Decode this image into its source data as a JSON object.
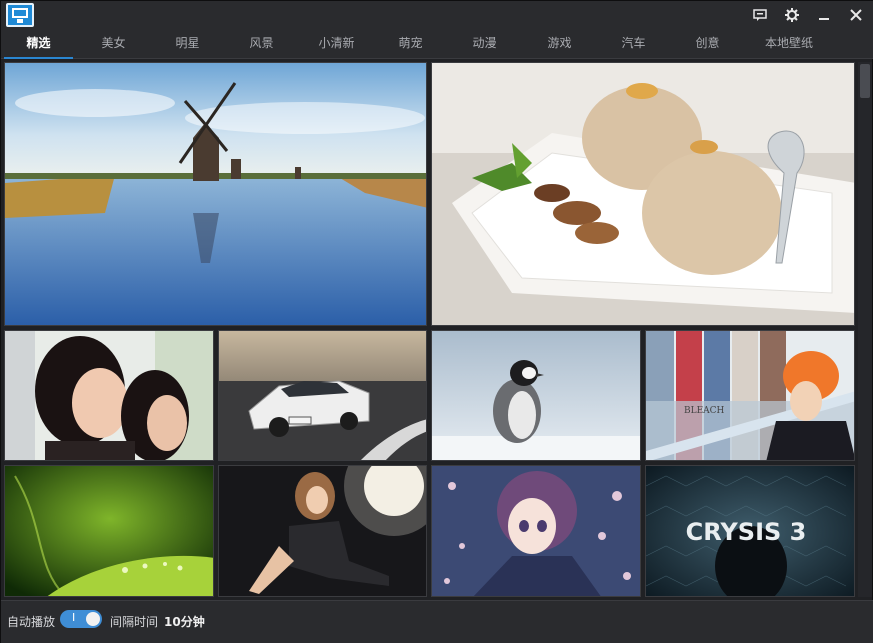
{
  "titlebar": {
    "icons": [
      "app-logo-icon",
      "feedback-icon",
      "settings-gear-icon",
      "minimize-icon",
      "close-icon"
    ]
  },
  "tabs": [
    {
      "label": "精选",
      "active": true
    },
    {
      "label": "美女",
      "active": false
    },
    {
      "label": "明星",
      "active": false
    },
    {
      "label": "风景",
      "active": false
    },
    {
      "label": "小清新",
      "active": false
    },
    {
      "label": "萌宠",
      "active": false
    },
    {
      "label": "动漫",
      "active": false
    },
    {
      "label": "游戏",
      "active": false
    },
    {
      "label": "汽车",
      "active": false
    },
    {
      "label": "创意",
      "active": false
    },
    {
      "label": "本地壁纸",
      "active": false
    }
  ],
  "gallery": {
    "tiles": [
      {
        "name": "windmill-landscape-image"
      },
      {
        "name": "ice-cream-dessert-image"
      },
      {
        "name": "two-women-portrait-image"
      },
      {
        "name": "white-sports-car-image"
      },
      {
        "name": "penguin-snow-image"
      },
      {
        "name": "anime-bleach-image"
      },
      {
        "name": "green-leaf-dew-image"
      },
      {
        "name": "woman-posing-image"
      },
      {
        "name": "anime-girl-flowers-image"
      },
      {
        "name": "game-crysis3-image",
        "text": "CRYSIS 3"
      }
    ]
  },
  "status": {
    "autoplay_label": "自动播放",
    "toggle_on": true,
    "toggle_mark": "I",
    "interval_label": "间隔时间",
    "interval_value": "10分钟"
  },
  "colors": {
    "accent": "#2a86d1",
    "background": "#202124",
    "bar": "#2a2b2e"
  }
}
